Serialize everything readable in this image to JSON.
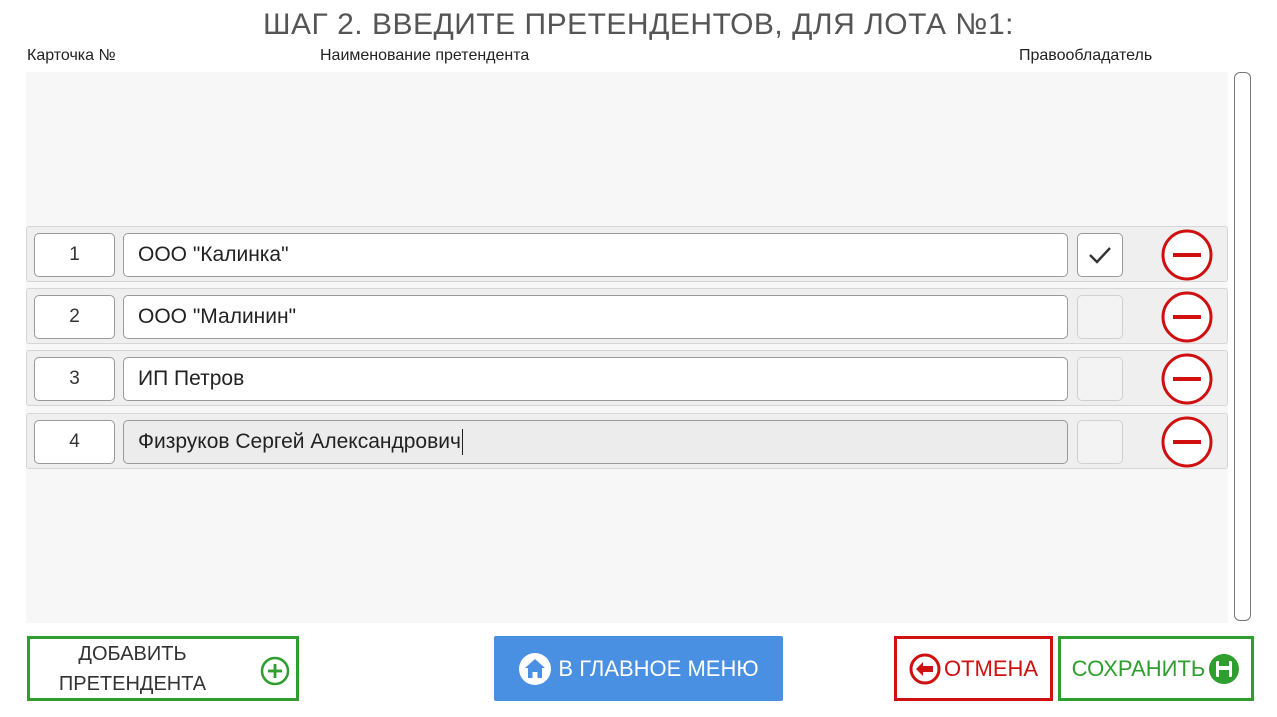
{
  "title": "ШАГ 2. ВВЕДИТЕ ПРЕТЕНДЕНТОВ, ДЛЯ ЛОТА №1:",
  "headers": {
    "card": "Карточка №",
    "name": "Наименование претендента",
    "owner": "Правообладатель"
  },
  "rows": [
    {
      "card": "1",
      "name": "ООО \"Калинка\"",
      "owner_checked": true
    },
    {
      "card": "2",
      "name": "ООО \"Малинин\"",
      "owner_checked": false
    },
    {
      "card": "3",
      "name": "ИП Петров",
      "owner_checked": false
    },
    {
      "card": "4",
      "name": "Физруков Сергей Александрович",
      "owner_checked": false,
      "focused": true
    }
  ],
  "buttons": {
    "add_line1": "ДОБАВИТЬ",
    "add_line2": "ПРЕТЕНДЕНТА",
    "main_menu": "В ГЛАВНОЕ МЕНЮ",
    "cancel": "ОТМЕНА",
    "save": "СОХРАНИТЬ"
  },
  "icons": {
    "add": "plus-circle-icon",
    "main_menu": "home-icon",
    "cancel": "arrow-left-circle-icon",
    "save": "floppy-disk-icon",
    "remove": "minus-circle-icon",
    "check": "checkmark-icon"
  },
  "colors": {
    "green": "#2e9e2e",
    "red": "#d01010",
    "blue": "#4a90e2"
  }
}
